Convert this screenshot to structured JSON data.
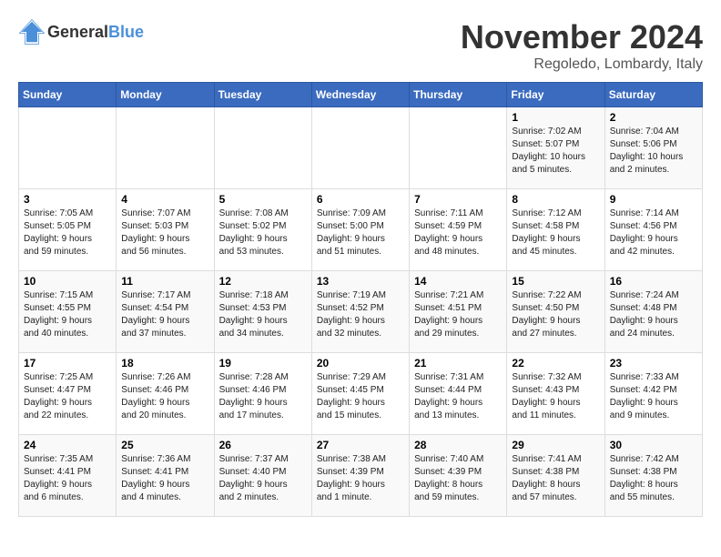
{
  "logo": {
    "general": "General",
    "blue": "Blue"
  },
  "title": "November 2024",
  "location": "Regoledo, Lombardy, Italy",
  "weekdays": [
    "Sunday",
    "Monday",
    "Tuesday",
    "Wednesday",
    "Thursday",
    "Friday",
    "Saturday"
  ],
  "weeks": [
    [
      {
        "day": "",
        "info": ""
      },
      {
        "day": "",
        "info": ""
      },
      {
        "day": "",
        "info": ""
      },
      {
        "day": "",
        "info": ""
      },
      {
        "day": "",
        "info": ""
      },
      {
        "day": "1",
        "info": "Sunrise: 7:02 AM\nSunset: 5:07 PM\nDaylight: 10 hours\nand 5 minutes."
      },
      {
        "day": "2",
        "info": "Sunrise: 7:04 AM\nSunset: 5:06 PM\nDaylight: 10 hours\nand 2 minutes."
      }
    ],
    [
      {
        "day": "3",
        "info": "Sunrise: 7:05 AM\nSunset: 5:05 PM\nDaylight: 9 hours\nand 59 minutes."
      },
      {
        "day": "4",
        "info": "Sunrise: 7:07 AM\nSunset: 5:03 PM\nDaylight: 9 hours\nand 56 minutes."
      },
      {
        "day": "5",
        "info": "Sunrise: 7:08 AM\nSunset: 5:02 PM\nDaylight: 9 hours\nand 53 minutes."
      },
      {
        "day": "6",
        "info": "Sunrise: 7:09 AM\nSunset: 5:00 PM\nDaylight: 9 hours\nand 51 minutes."
      },
      {
        "day": "7",
        "info": "Sunrise: 7:11 AM\nSunset: 4:59 PM\nDaylight: 9 hours\nand 48 minutes."
      },
      {
        "day": "8",
        "info": "Sunrise: 7:12 AM\nSunset: 4:58 PM\nDaylight: 9 hours\nand 45 minutes."
      },
      {
        "day": "9",
        "info": "Sunrise: 7:14 AM\nSunset: 4:56 PM\nDaylight: 9 hours\nand 42 minutes."
      }
    ],
    [
      {
        "day": "10",
        "info": "Sunrise: 7:15 AM\nSunset: 4:55 PM\nDaylight: 9 hours\nand 40 minutes."
      },
      {
        "day": "11",
        "info": "Sunrise: 7:17 AM\nSunset: 4:54 PM\nDaylight: 9 hours\nand 37 minutes."
      },
      {
        "day": "12",
        "info": "Sunrise: 7:18 AM\nSunset: 4:53 PM\nDaylight: 9 hours\nand 34 minutes."
      },
      {
        "day": "13",
        "info": "Sunrise: 7:19 AM\nSunset: 4:52 PM\nDaylight: 9 hours\nand 32 minutes."
      },
      {
        "day": "14",
        "info": "Sunrise: 7:21 AM\nSunset: 4:51 PM\nDaylight: 9 hours\nand 29 minutes."
      },
      {
        "day": "15",
        "info": "Sunrise: 7:22 AM\nSunset: 4:50 PM\nDaylight: 9 hours\nand 27 minutes."
      },
      {
        "day": "16",
        "info": "Sunrise: 7:24 AM\nSunset: 4:48 PM\nDaylight: 9 hours\nand 24 minutes."
      }
    ],
    [
      {
        "day": "17",
        "info": "Sunrise: 7:25 AM\nSunset: 4:47 PM\nDaylight: 9 hours\nand 22 minutes."
      },
      {
        "day": "18",
        "info": "Sunrise: 7:26 AM\nSunset: 4:46 PM\nDaylight: 9 hours\nand 20 minutes."
      },
      {
        "day": "19",
        "info": "Sunrise: 7:28 AM\nSunset: 4:46 PM\nDaylight: 9 hours\nand 17 minutes."
      },
      {
        "day": "20",
        "info": "Sunrise: 7:29 AM\nSunset: 4:45 PM\nDaylight: 9 hours\nand 15 minutes."
      },
      {
        "day": "21",
        "info": "Sunrise: 7:31 AM\nSunset: 4:44 PM\nDaylight: 9 hours\nand 13 minutes."
      },
      {
        "day": "22",
        "info": "Sunrise: 7:32 AM\nSunset: 4:43 PM\nDaylight: 9 hours\nand 11 minutes."
      },
      {
        "day": "23",
        "info": "Sunrise: 7:33 AM\nSunset: 4:42 PM\nDaylight: 9 hours\nand 9 minutes."
      }
    ],
    [
      {
        "day": "24",
        "info": "Sunrise: 7:35 AM\nSunset: 4:41 PM\nDaylight: 9 hours\nand 6 minutes."
      },
      {
        "day": "25",
        "info": "Sunrise: 7:36 AM\nSunset: 4:41 PM\nDaylight: 9 hours\nand 4 minutes."
      },
      {
        "day": "26",
        "info": "Sunrise: 7:37 AM\nSunset: 4:40 PM\nDaylight: 9 hours\nand 2 minutes."
      },
      {
        "day": "27",
        "info": "Sunrise: 7:38 AM\nSunset: 4:39 PM\nDaylight: 9 hours\nand 1 minute."
      },
      {
        "day": "28",
        "info": "Sunrise: 7:40 AM\nSunset: 4:39 PM\nDaylight: 8 hours\nand 59 minutes."
      },
      {
        "day": "29",
        "info": "Sunrise: 7:41 AM\nSunset: 4:38 PM\nDaylight: 8 hours\nand 57 minutes."
      },
      {
        "day": "30",
        "info": "Sunrise: 7:42 AM\nSunset: 4:38 PM\nDaylight: 8 hours\nand 55 minutes."
      }
    ]
  ]
}
